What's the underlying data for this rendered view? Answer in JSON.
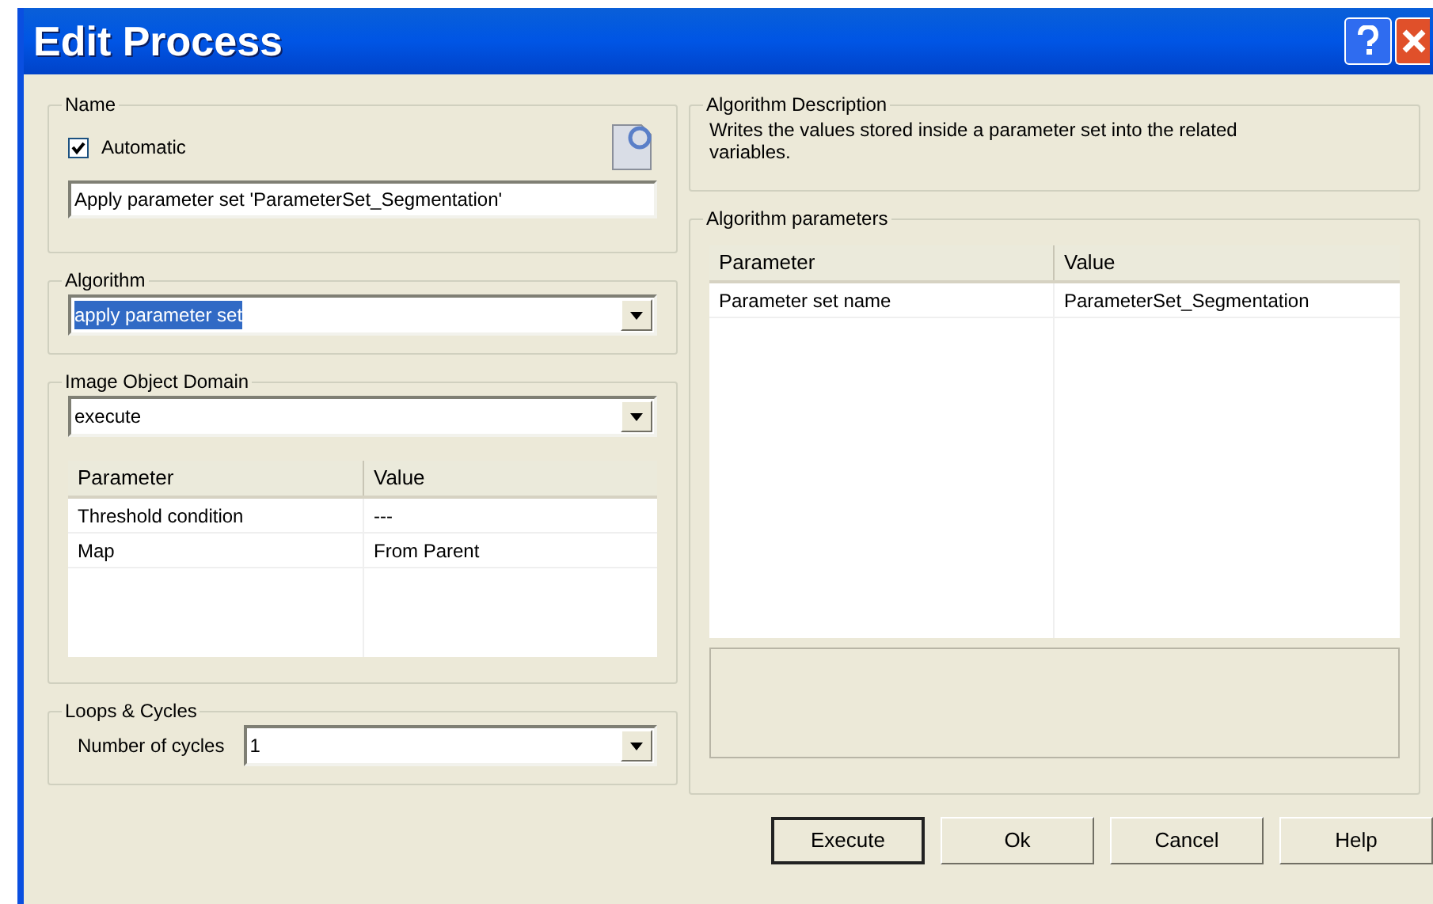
{
  "window": {
    "title": "Edit Process"
  },
  "name_group": {
    "legend": "Name",
    "automatic": {
      "label": "Automatic",
      "checked": true
    },
    "name_field": {
      "value": "Apply parameter set 'ParameterSet_Segmentation'"
    }
  },
  "algorithm_group": {
    "legend": "Algorithm",
    "value": "apply parameter set",
    "highlighted": true
  },
  "domain_group": {
    "legend": "Image Object Domain",
    "value": "execute",
    "columns": [
      "Parameter",
      "Value"
    ],
    "rows": [
      [
        "Threshold condition",
        "---"
      ],
      [
        "Map",
        "From Parent"
      ]
    ]
  },
  "loops_group": {
    "legend": "Loops & Cycles",
    "label": "Number of cycles",
    "value": "1"
  },
  "description_group": {
    "legend": "Algorithm Description",
    "text": "Writes the values stored inside a parameter set into the related variables."
  },
  "parameters_group": {
    "legend": "Algorithm parameters",
    "columns": [
      "Parameter",
      "Value"
    ],
    "rows": [
      [
        "Parameter set name",
        "ParameterSet_Segmentation"
      ]
    ]
  },
  "buttons": [
    {
      "label": "Execute",
      "default": true
    },
    {
      "label": "Ok",
      "default": false
    },
    {
      "label": "Cancel",
      "default": false
    },
    {
      "label": "Help",
      "default": false
    }
  ]
}
